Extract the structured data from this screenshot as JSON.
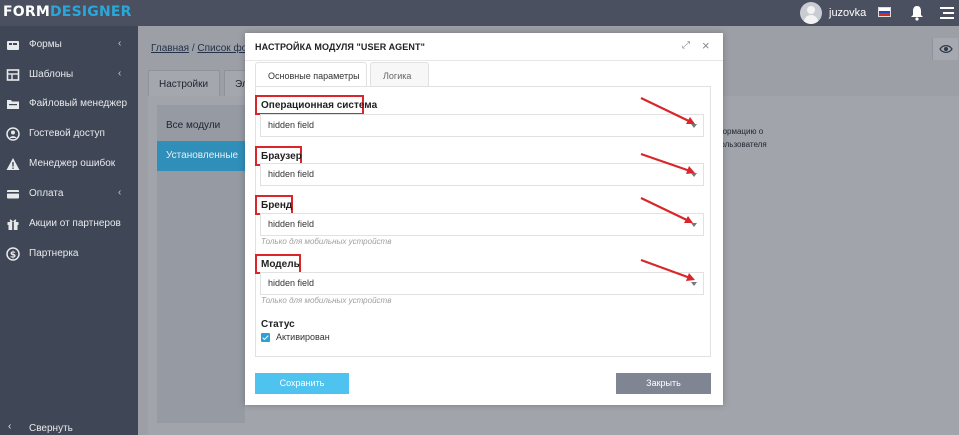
{
  "app": {
    "logo_part1": "FORM",
    "logo_part2": "DESIGNER",
    "username": "juzovka"
  },
  "sidebar": {
    "items": [
      {
        "label": "Формы",
        "icon": "forms-icon",
        "has_chevron": true
      },
      {
        "label": "Шаблоны",
        "icon": "templates-icon",
        "has_chevron": true
      },
      {
        "label": "Файловый менеджер",
        "icon": "file-manager-icon",
        "has_chevron": false
      },
      {
        "label": "Гостевой доступ",
        "icon": "guest-access-icon",
        "has_chevron": false
      },
      {
        "label": "Менеджер ошибок",
        "icon": "warning-icon",
        "has_chevron": false
      },
      {
        "label": "Оплата",
        "icon": "payment-icon",
        "has_chevron": true
      },
      {
        "label": "Акции от партнеров",
        "icon": "gift-icon",
        "has_chevron": false
      },
      {
        "label": "Партнерка",
        "icon": "dollar-icon",
        "has_chevron": false
      }
    ],
    "chevron": "‹",
    "collapse_label": "Свернуть",
    "collapse_icon": "‹"
  },
  "main": {
    "breadcrumb_home": "Главная",
    "breadcrumb_sep": " / ",
    "breadcrumb_list": "Список форм",
    "tabs": [
      {
        "label": "Настройки"
      },
      {
        "label": "Эл"
      }
    ],
    "modules": [
      {
        "label": "Все модули",
        "active": false
      },
      {
        "label": "Установленные",
        "active": true
      }
    ],
    "hint_line1": "формацию о",
    "hint_line2": "пользователя"
  },
  "modal": {
    "title": "НАСТРОЙКА МОДУЛЯ \"USER AGENT\"",
    "tabs": [
      {
        "label": "Основные параметры",
        "active": true
      },
      {
        "label": "Логика",
        "active": false
      }
    ],
    "fields": [
      {
        "label": "Операционная система",
        "value": "hidden field",
        "help": ""
      },
      {
        "label": "Браузер",
        "value": "hidden field",
        "help": ""
      },
      {
        "label": "Бренд",
        "value": "hidden field",
        "help": "Только для мобильных устройств"
      },
      {
        "label": "Модель",
        "value": "hidden field",
        "help": "Только для мобильных устройств"
      }
    ],
    "status_label": "Статус",
    "status_checkbox_label": "Активирован",
    "status_checked": true,
    "save_button": "Сохранить",
    "close_button": "Закрыть"
  },
  "colors": {
    "accent": "#2aa7d8",
    "annotation_red": "#d9262a",
    "sidebar_bg": "#3f4756",
    "save_button": "#4fc3ef",
    "close_button": "#7f8593"
  }
}
